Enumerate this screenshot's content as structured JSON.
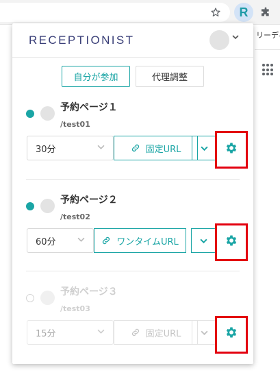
{
  "browser": {
    "star_icon": "star-icon",
    "extension_letter": "R",
    "puzzle_icon": "puzzle-icon",
    "side_text": "リーディ"
  },
  "popup": {
    "logo": "RECEPTIONIST",
    "tabs": [
      {
        "label": "自分が参加",
        "active": true
      },
      {
        "label": "代理調整",
        "active": false
      }
    ],
    "pages": [
      {
        "title": "予約ページ１",
        "path": "/test01",
        "duration": "30分",
        "url_type": "固定URL",
        "enabled": true
      },
      {
        "title": "予約ページ２",
        "path": "/test02",
        "duration": "60分",
        "url_type": "ワンタイムURL",
        "enabled": true
      },
      {
        "title": "予約ページ３",
        "path": "/test03",
        "duration": "15分",
        "url_type": "固定URL",
        "enabled": false
      }
    ]
  },
  "colors": {
    "accent": "#1aa5a5",
    "highlight": "#e3000f",
    "logo": "#3a3f78"
  }
}
